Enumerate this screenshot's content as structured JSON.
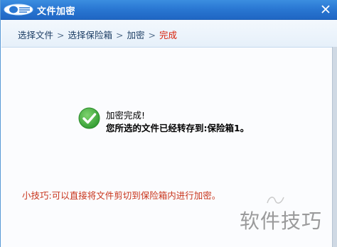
{
  "window": {
    "title": "文件加密"
  },
  "breadcrumb": {
    "steps": [
      {
        "label": "选择文件"
      },
      {
        "label": "选择保险箱"
      },
      {
        "label": "加密"
      },
      {
        "label": "完成"
      }
    ],
    "separator": ">",
    "active_index": 3,
    "active_color": "#d81e06"
  },
  "result": {
    "status": "加密完成!",
    "detail": "您所选的文件已经转存到:保险箱1。",
    "icon": "success-check-icon"
  },
  "tip": {
    "text": "小技巧:可以直接将文件剪切到保险箱内进行加密。",
    "color": "#c8331a"
  },
  "watermark": {
    "text": "软件技巧"
  },
  "colors": {
    "titlebar": "#2a78d3",
    "check": "#3aa43a"
  }
}
